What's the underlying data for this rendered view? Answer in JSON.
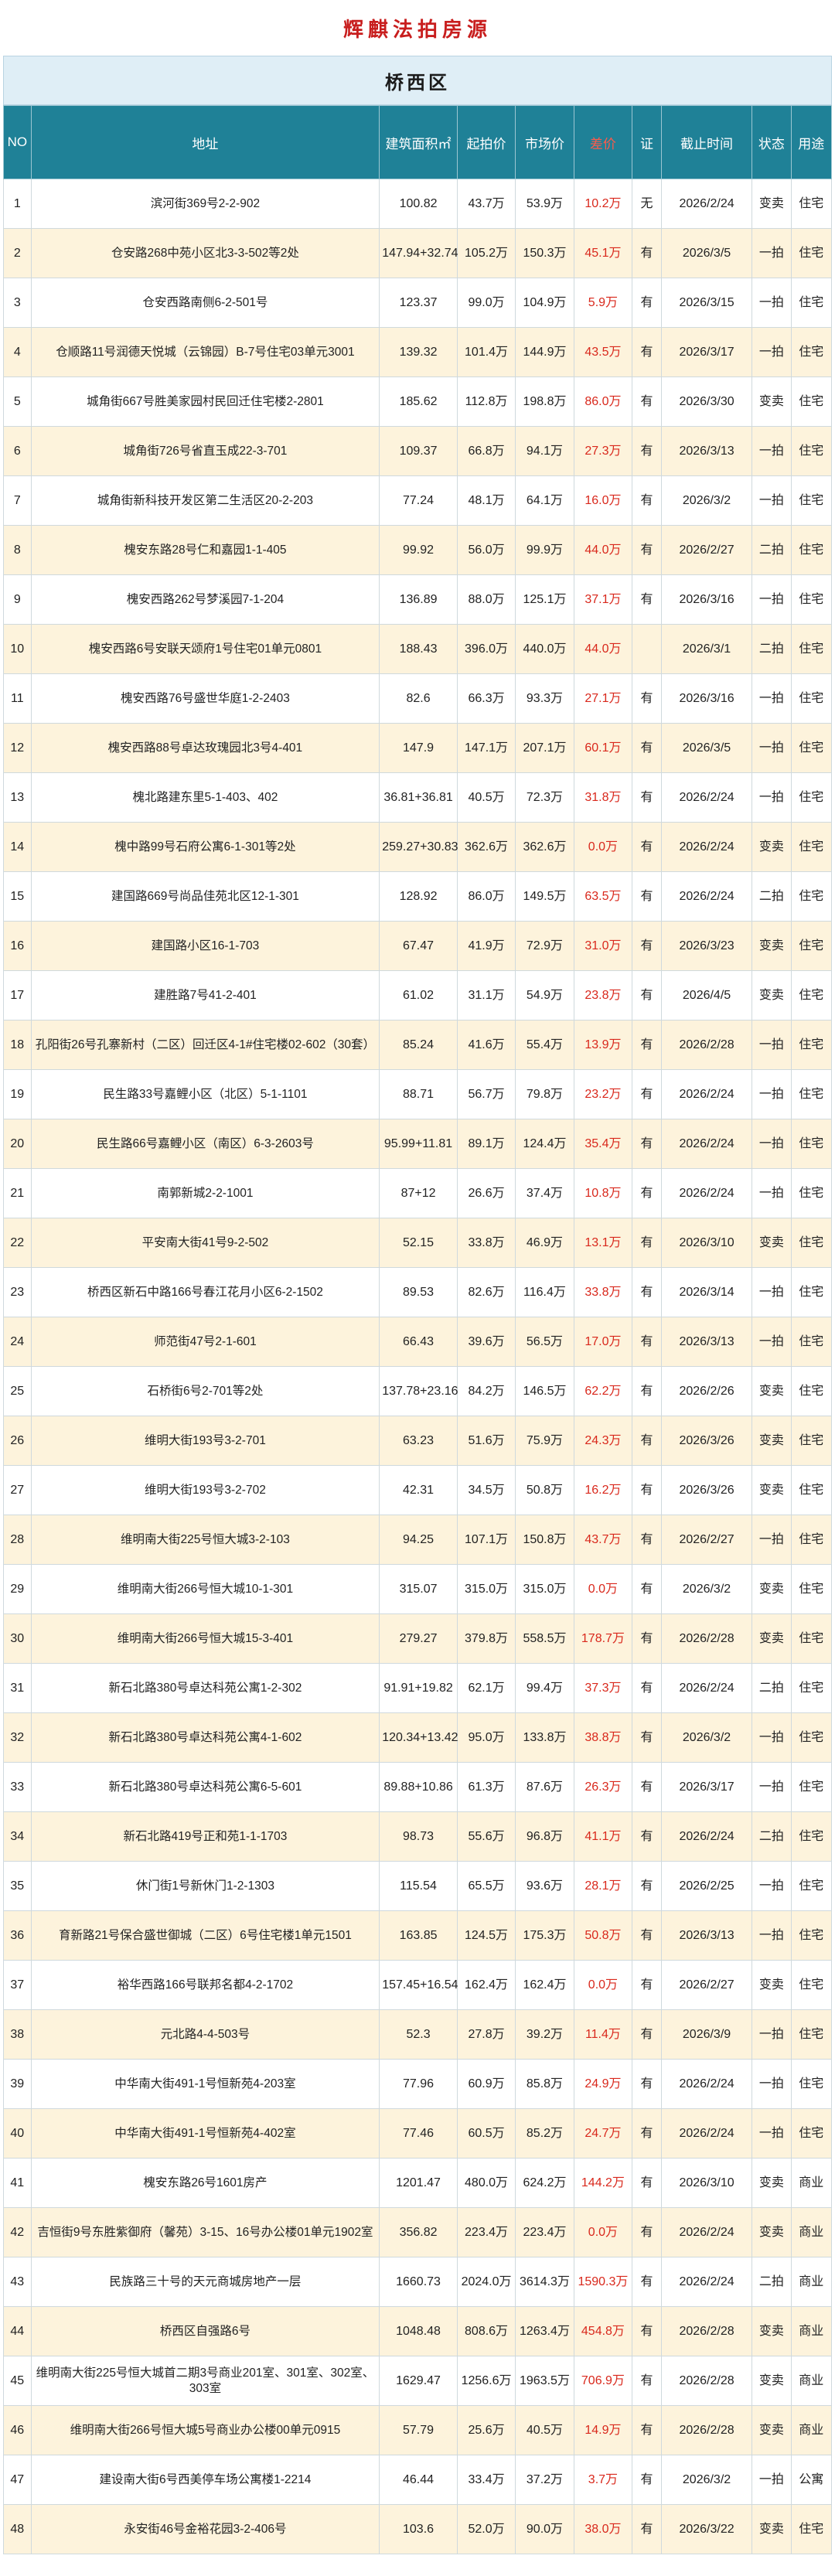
{
  "page_title": "辉麒法拍房源",
  "district": "桥西区",
  "headers": {
    "no": "NO",
    "address": "地址",
    "area": "建筑面积㎡",
    "start_price": "起拍价",
    "market_price": "市场价",
    "diff": "差价",
    "cert": "证",
    "deadline": "截止时间",
    "status": "状态",
    "usage": "用途"
  },
  "rows": [
    {
      "no": "1",
      "address": "滨河街369号2-2-902",
      "area": "100.82",
      "start": "43.7万",
      "market": "53.9万",
      "diff": "10.2万",
      "cert": "无",
      "deadline": "2026/2/24",
      "status": "变卖",
      "usage": "住宅"
    },
    {
      "no": "2",
      "address": "仓安路268中苑小区北3-3-502等2处",
      "area": "147.94+32.74",
      "start": "105.2万",
      "market": "150.3万",
      "diff": "45.1万",
      "cert": "有",
      "deadline": "2026/3/5",
      "status": "一拍",
      "usage": "住宅"
    },
    {
      "no": "3",
      "address": "仓安西路南侧6-2-501号",
      "area": "123.37",
      "start": "99.0万",
      "market": "104.9万",
      "diff": "5.9万",
      "cert": "有",
      "deadline": "2026/3/15",
      "status": "一拍",
      "usage": "住宅"
    },
    {
      "no": "4",
      "address": "仓顺路11号润德天悦城（云锦园）B-7号住宅03单元3001",
      "area": "139.32",
      "start": "101.4万",
      "market": "144.9万",
      "diff": "43.5万",
      "cert": "有",
      "deadline": "2026/3/17",
      "status": "一拍",
      "usage": "住宅"
    },
    {
      "no": "5",
      "address": "城角街667号胜美家园村民回迁住宅楼2-2801",
      "area": "185.62",
      "start": "112.8万",
      "market": "198.8万",
      "diff": "86.0万",
      "cert": "有",
      "deadline": "2026/3/30",
      "status": "变卖",
      "usage": "住宅"
    },
    {
      "no": "6",
      "address": "城角街726号省直玉成22-3-701",
      "area": "109.37",
      "start": "66.8万",
      "market": "94.1万",
      "diff": "27.3万",
      "cert": "有",
      "deadline": "2026/3/13",
      "status": "一拍",
      "usage": "住宅"
    },
    {
      "no": "7",
      "address": "城角街新科技开发区第二生活区20-2-203",
      "area": "77.24",
      "start": "48.1万",
      "market": "64.1万",
      "diff": "16.0万",
      "cert": "有",
      "deadline": "2026/3/2",
      "status": "一拍",
      "usage": "住宅"
    },
    {
      "no": "8",
      "address": "槐安东路28号仁和嘉园1-1-405",
      "area": "99.92",
      "start": "56.0万",
      "market": "99.9万",
      "diff": "44.0万",
      "cert": "有",
      "deadline": "2026/2/27",
      "status": "二拍",
      "usage": "住宅"
    },
    {
      "no": "9",
      "address": "槐安西路262号梦溪园7-1-204",
      "area": "136.89",
      "start": "88.0万",
      "market": "125.1万",
      "diff": "37.1万",
      "cert": "有",
      "deadline": "2026/3/16",
      "status": "一拍",
      "usage": "住宅"
    },
    {
      "no": "10",
      "address": "槐安西路6号安联天颂府1号住宅01单元0801",
      "area": "188.43",
      "start": "396.0万",
      "market": "440.0万",
      "diff": "44.0万",
      "cert": "",
      "deadline": "2026/3/1",
      "status": "二拍",
      "usage": "住宅"
    },
    {
      "no": "11",
      "address": "槐安西路76号盛世华庭1-2-2403",
      "area": "82.6",
      "start": "66.3万",
      "market": "93.3万",
      "diff": "27.1万",
      "cert": "有",
      "deadline": "2026/3/16",
      "status": "一拍",
      "usage": "住宅"
    },
    {
      "no": "12",
      "address": "槐安西路88号卓达玫瑰园北3号4-401",
      "area": "147.9",
      "start": "147.1万",
      "market": "207.1万",
      "diff": "60.1万",
      "cert": "有",
      "deadline": "2026/3/5",
      "status": "一拍",
      "usage": "住宅"
    },
    {
      "no": "13",
      "address": "槐北路建东里5-1-403、402",
      "area": "36.81+36.81",
      "start": "40.5万",
      "market": "72.3万",
      "diff": "31.8万",
      "cert": "有",
      "deadline": "2026/2/24",
      "status": "一拍",
      "usage": "住宅"
    },
    {
      "no": "14",
      "address": "槐中路99号石府公寓6-1-301等2处",
      "area": "259.27+30.83",
      "start": "362.6万",
      "market": "362.6万",
      "diff": "0.0万",
      "cert": "有",
      "deadline": "2026/2/24",
      "status": "变卖",
      "usage": "住宅"
    },
    {
      "no": "15",
      "address": "建国路669号尚品佳苑北区12-1-301",
      "area": "128.92",
      "start": "86.0万",
      "market": "149.5万",
      "diff": "63.5万",
      "cert": "有",
      "deadline": "2026/2/24",
      "status": "二拍",
      "usage": "住宅"
    },
    {
      "no": "16",
      "address": "建国路小区16-1-703",
      "area": "67.47",
      "start": "41.9万",
      "market": "72.9万",
      "diff": "31.0万",
      "cert": "有",
      "deadline": "2026/3/23",
      "status": "变卖",
      "usage": "住宅"
    },
    {
      "no": "17",
      "address": "建胜路7号41-2-401",
      "area": "61.02",
      "start": "31.1万",
      "market": "54.9万",
      "diff": "23.8万",
      "cert": "有",
      "deadline": "2026/4/5",
      "status": "变卖",
      "usage": "住宅"
    },
    {
      "no": "18",
      "address": "孔阳街26号孔寨新村（二区）回迁区4-1#住宅楼02-602（30套）",
      "area": "85.24",
      "start": "41.6万",
      "market": "55.4万",
      "diff": "13.9万",
      "cert": "有",
      "deadline": "2026/2/28",
      "status": "一拍",
      "usage": "住宅"
    },
    {
      "no": "19",
      "address": "民生路33号嘉鲤小区（北区）5-1-1101",
      "area": "88.71",
      "start": "56.7万",
      "market": "79.8万",
      "diff": "23.2万",
      "cert": "有",
      "deadline": "2026/2/24",
      "status": "一拍",
      "usage": "住宅"
    },
    {
      "no": "20",
      "address": "民生路66号嘉鲤小区（南区）6-3-2603号",
      "area": "95.99+11.81",
      "start": "89.1万",
      "market": "124.4万",
      "diff": "35.4万",
      "cert": "有",
      "deadline": "2026/2/24",
      "status": "一拍",
      "usage": "住宅"
    },
    {
      "no": "21",
      "address": "南郭新城2-2-1001",
      "area": "87+12",
      "start": "26.6万",
      "market": "37.4万",
      "diff": "10.8万",
      "cert": "有",
      "deadline": "2026/2/24",
      "status": "一拍",
      "usage": "住宅"
    },
    {
      "no": "22",
      "address": "平安南大街41号9-2-502",
      "area": "52.15",
      "start": "33.8万",
      "market": "46.9万",
      "diff": "13.1万",
      "cert": "有",
      "deadline": "2026/3/10",
      "status": "变卖",
      "usage": "住宅"
    },
    {
      "no": "23",
      "address": "桥西区新石中路166号春江花月小区6-2-1502",
      "area": "89.53",
      "start": "82.6万",
      "market": "116.4万",
      "diff": "33.8万",
      "cert": "有",
      "deadline": "2026/3/14",
      "status": "一拍",
      "usage": "住宅"
    },
    {
      "no": "24",
      "address": "师范街47号2-1-601",
      "area": "66.43",
      "start": "39.6万",
      "market": "56.5万",
      "diff": "17.0万",
      "cert": "有",
      "deadline": "2026/3/13",
      "status": "一拍",
      "usage": "住宅"
    },
    {
      "no": "25",
      "address": "石桥街6号2-701等2处",
      "area": "137.78+23.16",
      "start": "84.2万",
      "market": "146.5万",
      "diff": "62.2万",
      "cert": "有",
      "deadline": "2026/2/26",
      "status": "变卖",
      "usage": "住宅"
    },
    {
      "no": "26",
      "address": "维明大街193号3-2-701",
      "area": "63.23",
      "start": "51.6万",
      "market": "75.9万",
      "diff": "24.3万",
      "cert": "有",
      "deadline": "2026/3/26",
      "status": "变卖",
      "usage": "住宅"
    },
    {
      "no": "27",
      "address": "维明大街193号3-2-702",
      "area": "42.31",
      "start": "34.5万",
      "market": "50.8万",
      "diff": "16.2万",
      "cert": "有",
      "deadline": "2026/3/26",
      "status": "变卖",
      "usage": "住宅"
    },
    {
      "no": "28",
      "address": "维明南大街225号恒大城3-2-103",
      "area": "94.25",
      "start": "107.1万",
      "market": "150.8万",
      "diff": "43.7万",
      "cert": "有",
      "deadline": "2026/2/27",
      "status": "一拍",
      "usage": "住宅"
    },
    {
      "no": "29",
      "address": "维明南大街266号恒大城10-1-301",
      "area": "315.07",
      "start": "315.0万",
      "market": "315.0万",
      "diff": "0.0万",
      "cert": "有",
      "deadline": "2026/3/2",
      "status": "变卖",
      "usage": "住宅"
    },
    {
      "no": "30",
      "address": "维明南大街266号恒大城15-3-401",
      "area": "279.27",
      "start": "379.8万",
      "market": "558.5万",
      "diff": "178.7万",
      "cert": "有",
      "deadline": "2026/2/28",
      "status": "变卖",
      "usage": "住宅"
    },
    {
      "no": "31",
      "address": "新石北路380号卓达科苑公寓1-2-302",
      "area": "91.91+19.82",
      "start": "62.1万",
      "market": "99.4万",
      "diff": "37.3万",
      "cert": "有",
      "deadline": "2026/2/24",
      "status": "二拍",
      "usage": "住宅"
    },
    {
      "no": "32",
      "address": "新石北路380号卓达科苑公寓4-1-602",
      "area": "120.34+13.42",
      "start": "95.0万",
      "market": "133.8万",
      "diff": "38.8万",
      "cert": "有",
      "deadline": "2026/3/2",
      "status": "一拍",
      "usage": "住宅"
    },
    {
      "no": "33",
      "address": "新石北路380号卓达科苑公寓6-5-601",
      "area": "89.88+10.86",
      "start": "61.3万",
      "market": "87.6万",
      "diff": "26.3万",
      "cert": "有",
      "deadline": "2026/3/17",
      "status": "一拍",
      "usage": "住宅"
    },
    {
      "no": "34",
      "address": "新石北路419号正和苑1-1-1703",
      "area": "98.73",
      "start": "55.6万",
      "market": "96.8万",
      "diff": "41.1万",
      "cert": "有",
      "deadline": "2026/2/24",
      "status": "二拍",
      "usage": "住宅"
    },
    {
      "no": "35",
      "address": "休门街1号新休门1-2-1303",
      "area": "115.54",
      "start": "65.5万",
      "market": "93.6万",
      "diff": "28.1万",
      "cert": "有",
      "deadline": "2026/2/25",
      "status": "一拍",
      "usage": "住宅"
    },
    {
      "no": "36",
      "address": "育新路21号保合盛世御城（二区）6号住宅楼1单元1501",
      "area": "163.85",
      "start": "124.5万",
      "market": "175.3万",
      "diff": "50.8万",
      "cert": "有",
      "deadline": "2026/3/13",
      "status": "一拍",
      "usage": "住宅"
    },
    {
      "no": "37",
      "address": "裕华西路166号联邦名都4-2-1702",
      "area": "157.45+16.54",
      "start": "162.4万",
      "market": "162.4万",
      "diff": "0.0万",
      "cert": "有",
      "deadline": "2026/2/27",
      "status": "变卖",
      "usage": "住宅"
    },
    {
      "no": "38",
      "address": "元北路4-4-503号",
      "area": "52.3",
      "start": "27.8万",
      "market": "39.2万",
      "diff": "11.4万",
      "cert": "有",
      "deadline": "2026/3/9",
      "status": "一拍",
      "usage": "住宅"
    },
    {
      "no": "39",
      "address": "中华南大街491-1号恒新苑4-203室",
      "area": "77.96",
      "start": "60.9万",
      "market": "85.8万",
      "diff": "24.9万",
      "cert": "有",
      "deadline": "2026/2/24",
      "status": "一拍",
      "usage": "住宅"
    },
    {
      "no": "40",
      "address": "中华南大街491-1号恒新苑4-402室",
      "area": "77.46",
      "start": "60.5万",
      "market": "85.2万",
      "diff": "24.7万",
      "cert": "有",
      "deadline": "2026/2/24",
      "status": "一拍",
      "usage": "住宅"
    },
    {
      "no": "41",
      "address": "槐安东路26号1601房产",
      "area": "1201.47",
      "start": "480.0万",
      "market": "624.2万",
      "diff": "144.2万",
      "cert": "有",
      "deadline": "2026/3/10",
      "status": "变卖",
      "usage": "商业"
    },
    {
      "no": "42",
      "address": "吉恒街9号东胜紫御府（馨苑）3-15、16号办公楼01单元1902室",
      "area": "356.82",
      "start": "223.4万",
      "market": "223.4万",
      "diff": "0.0万",
      "cert": "有",
      "deadline": "2026/2/24",
      "status": "变卖",
      "usage": "商业"
    },
    {
      "no": "43",
      "address": "民族路三十号的天元商城房地产一层",
      "area": "1660.73",
      "start": "2024.0万",
      "market": "3614.3万",
      "diff": "1590.3万",
      "cert": "有",
      "deadline": "2026/2/24",
      "status": "二拍",
      "usage": "商业"
    },
    {
      "no": "44",
      "address": "桥西区自强路6号",
      "area": "1048.48",
      "start": "808.6万",
      "market": "1263.4万",
      "diff": "454.8万",
      "cert": "有",
      "deadline": "2026/2/28",
      "status": "变卖",
      "usage": "商业"
    },
    {
      "no": "45",
      "address": "维明南大街225号恒大城首二期3号商业201室、301室、302室、303室",
      "area": "1629.47",
      "start": "1256.6万",
      "market": "1963.5万",
      "diff": "706.9万",
      "cert": "有",
      "deadline": "2026/2/28",
      "status": "变卖",
      "usage": "商业"
    },
    {
      "no": "46",
      "address": "维明南大街266号恒大城5号商业办公楼00单元0915",
      "area": "57.79",
      "start": "25.6万",
      "market": "40.5万",
      "diff": "14.9万",
      "cert": "有",
      "deadline": "2026/2/28",
      "status": "变卖",
      "usage": "商业"
    },
    {
      "no": "47",
      "address": "建设南大街6号西美停车场公寓楼1-2214",
      "area": "46.44",
      "start": "33.4万",
      "market": "37.2万",
      "diff": "3.7万",
      "cert": "有",
      "deadline": "2026/3/2",
      "status": "一拍",
      "usage": "公寓"
    },
    {
      "no": "48",
      "address": "永安街46号金裕花园3-2-406号",
      "area": "103.6",
      "start": "52.0万",
      "market": "90.0万",
      "diff": "38.0万",
      "cert": "有",
      "deadline": "2026/3/22",
      "status": "变卖",
      "usage": "住宅"
    }
  ]
}
